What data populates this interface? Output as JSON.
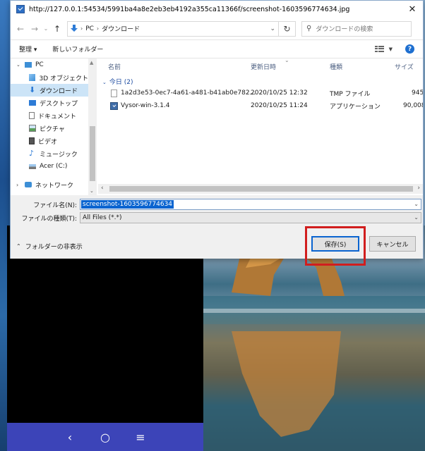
{
  "window": {
    "title": "http://127.0.0.1:54534/5991ba4a8e2eb3eb4192a355ca11366f/screenshot-1603596774634.jpg"
  },
  "navigation": {
    "path": [
      "PC",
      "ダウンロード"
    ],
    "search_placeholder": "ダウンロードの検索"
  },
  "toolbar": {
    "organize_label": "整理 ▾",
    "new_folder_label": "新しいフォルダー"
  },
  "nav_pane": {
    "items": [
      {
        "label": "PC",
        "icon": "monitor-icon"
      },
      {
        "label": "3D オブジェクト",
        "icon": "cube-icon"
      },
      {
        "label": "ダウンロード",
        "icon": "download-icon",
        "selected": true
      },
      {
        "label": "デスクトップ",
        "icon": "desktop-icon"
      },
      {
        "label": "ドキュメント",
        "icon": "document-icon"
      },
      {
        "label": "ピクチャ",
        "icon": "picture-icon"
      },
      {
        "label": "ビデオ",
        "icon": "video-icon"
      },
      {
        "label": "ミュージック",
        "icon": "music-icon"
      },
      {
        "label": "Acer (C:)",
        "icon": "drive-icon"
      },
      {
        "label": "ネットワーク",
        "icon": "network-icon"
      }
    ]
  },
  "file_list": {
    "columns": [
      "名前",
      "更新日時",
      "種類",
      "サイズ"
    ],
    "group_label": "今日 (2)",
    "rows": [
      {
        "name": "1a2d3e53-0ec7-4a61-a481-b41ab0e782...",
        "date": "2020/10/25 12:32",
        "type": "TMP ファイル",
        "size": "945",
        "icon": "file-icon"
      },
      {
        "name": "Vysor-win-3.1.4",
        "date": "2020/10/25 11:24",
        "type": "アプリケーション",
        "size": "90,008",
        "icon": "application-icon"
      }
    ]
  },
  "form": {
    "filename_label": "ファイル名(N):",
    "filename_value": "screenshot-1603596774634",
    "filetype_label": "ファイルの種類(T):",
    "filetype_value": "All Files (*.*)",
    "hide_folders_label": "フォルダーの非表示",
    "save_label": "保存(S)",
    "cancel_label": "キャンセル"
  },
  "phone_nav": {
    "back": "‹",
    "home": "○",
    "menu": "≡"
  },
  "colors": {
    "accent": "#0a64d0",
    "highlight_border": "#d11e1e",
    "selection_bg": "#cce4f7",
    "phone_nav_bg": "#3c44b8"
  }
}
